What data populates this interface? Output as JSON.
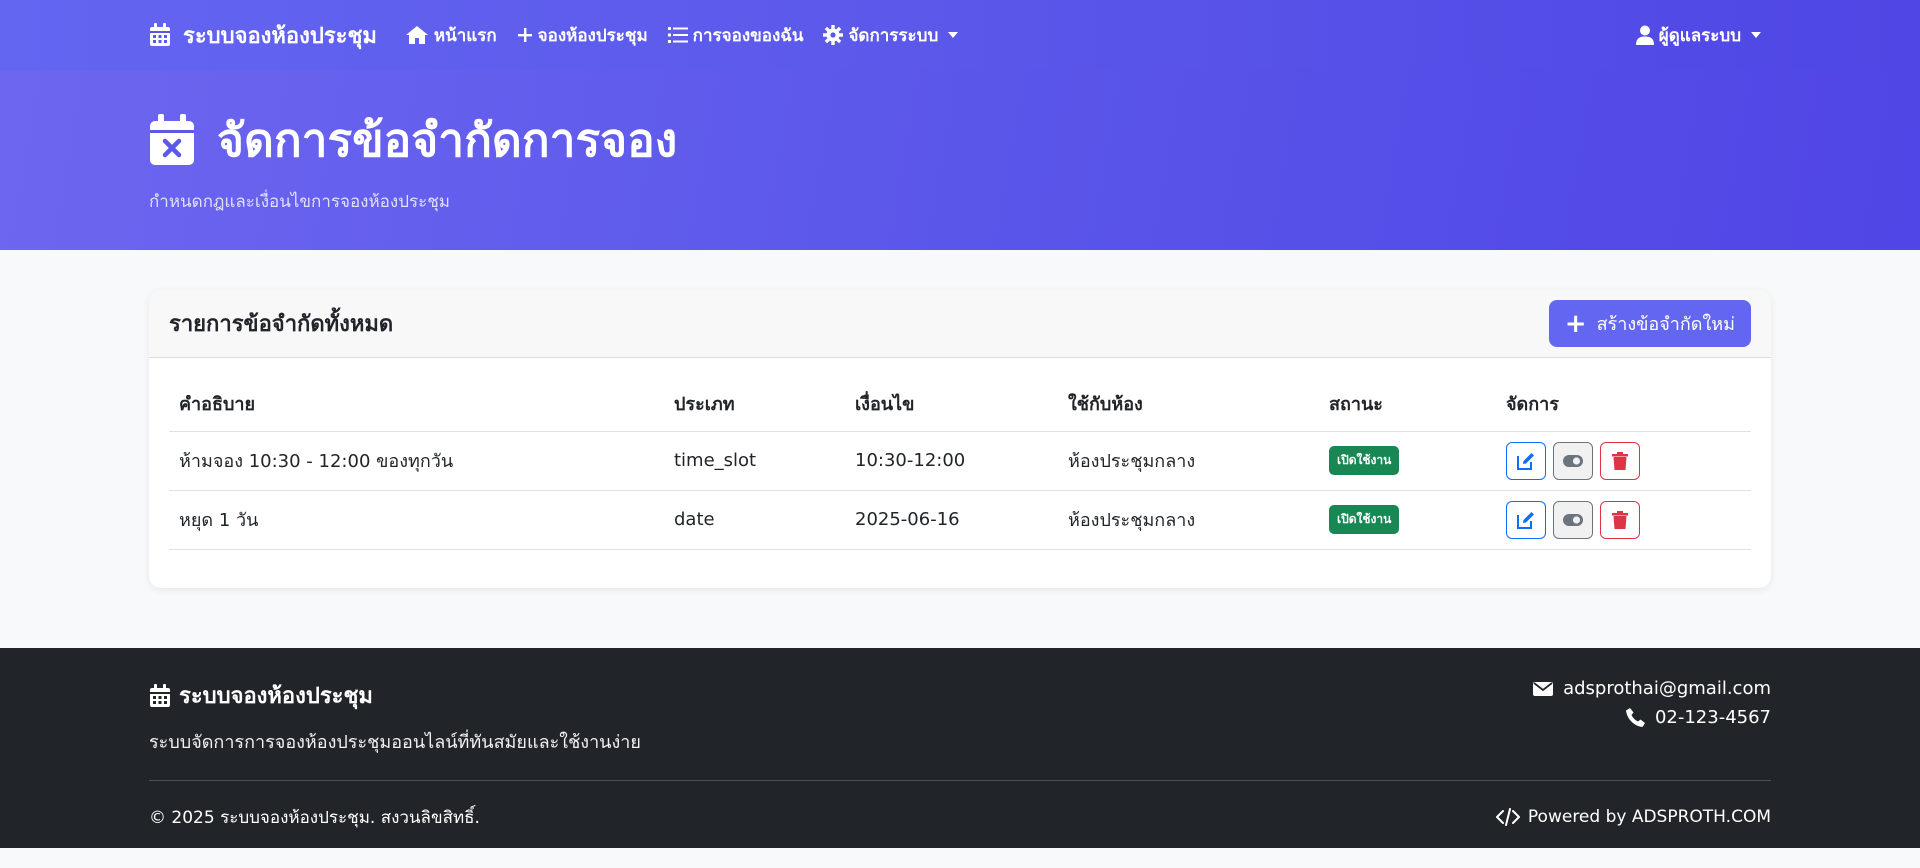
{
  "navbar": {
    "brand": "ระบบจองห้องประชุม",
    "links": [
      {
        "label": "หน้าแรก",
        "icon": "home-icon"
      },
      {
        "label": "จองห้องประชุม",
        "icon": "plus-icon"
      },
      {
        "label": "การจองของฉัน",
        "icon": "list-icon"
      },
      {
        "label": "จัดการระบบ",
        "icon": "gear-icon"
      }
    ],
    "user": "ผู้ดูแลระบบ"
  },
  "hero": {
    "title": "จัดการข้อจำกัดการจอง",
    "subtitle": "กำหนดกฎและเงื่อนไขการจองห้องประชุม"
  },
  "card": {
    "title": "รายการข้อจำกัดทั้งหมด",
    "create_button": "สร้างข้อจำกัดใหม่",
    "columns": [
      "คำอธิบาย",
      "ประเภท",
      "เงื่อนไข",
      "ใช้กับห้อง",
      "สถานะ",
      "จัดการ"
    ],
    "rows": [
      {
        "description": "ห้ามจอง 10:30 - 12:00 ของทุกวัน",
        "type": "time_slot",
        "condition": "10:30-12:00",
        "room": "ห้องประชุมกลาง",
        "status": "เปิดใช้งาน"
      },
      {
        "description": "หยุด 1 วัน",
        "type": "date",
        "condition": "2025-06-16",
        "room": "ห้องประชุมกลาง",
        "status": "เปิดใช้งาน"
      }
    ]
  },
  "footer": {
    "brand": "ระบบจองห้องประชุม",
    "description": "ระบบจัดการการจองห้องประชุมออนไลน์ที่ทันสมัยและใช้งานง่าย",
    "email": "adsprothai@gmail.com",
    "phone": "02-123-4567",
    "copyright": "© 2025 ระบบจองห้องประชุม. สงวนลิขสิทธิ์.",
    "powered": "Powered by ADSPROTH.COM"
  },
  "colors": {
    "primary": "#6366f1",
    "success": "#198754",
    "danger": "#dc3545",
    "info": "#0d6efd",
    "footer_bg": "#212529"
  }
}
